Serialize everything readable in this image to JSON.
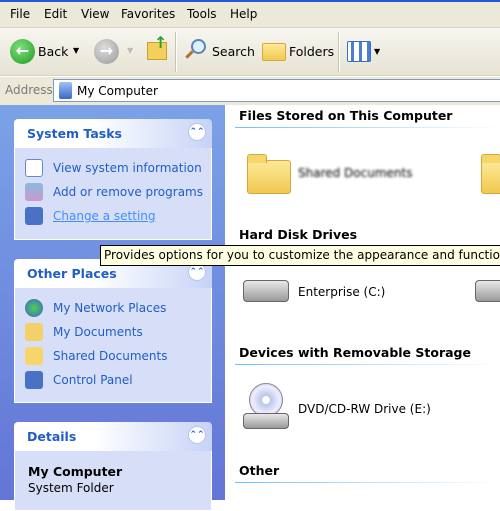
{
  "menu": [
    "File",
    "Edit",
    "View",
    "Favorites",
    "Tools",
    "Help"
  ],
  "toolbar": {
    "back": "Back",
    "search": "Search",
    "folders": "Folders"
  },
  "address": {
    "label": "Address",
    "value": "My Computer"
  },
  "panels": {
    "system_tasks": {
      "title": "System Tasks",
      "items": [
        "View system information",
        "Add or remove programs",
        "Change a setting"
      ]
    },
    "other_places": {
      "title": "Other Places",
      "items": [
        "My Network Places",
        "My Documents",
        "Shared Documents",
        "Control Panel"
      ]
    },
    "details": {
      "title": "Details",
      "name": "My Computer",
      "type": "System Folder"
    }
  },
  "content": {
    "files_header": "Files Stored on This Computer",
    "folder1": "Shared Documents",
    "hdd_header": "Hard Disk Drives",
    "drive1": "Enterprise (C:)",
    "removable_header": "Devices with Removable Storage",
    "dvd": "DVD/CD-RW Drive (E:)",
    "other_header": "Other"
  },
  "tooltip": "Provides options for you to customize the appearance and functionality of your computer."
}
